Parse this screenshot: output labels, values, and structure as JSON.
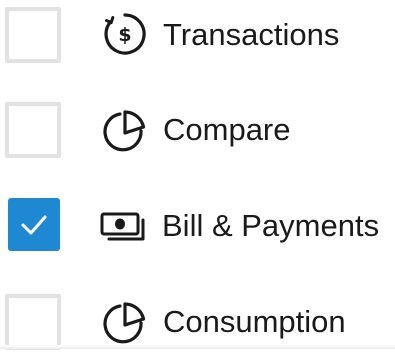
{
  "menu": {
    "items": [
      {
        "label": "Transactions",
        "checked": false,
        "icon": "dollar-circle-icon"
      },
      {
        "label": "Compare",
        "checked": false,
        "icon": "pie-chart-icon"
      },
      {
        "label": "Bill & Payments",
        "checked": true,
        "icon": "cash-icon"
      },
      {
        "label": "Consumption",
        "checked": false,
        "icon": "pie-chart-icon"
      }
    ]
  },
  "colors": {
    "accent": "#1e88d2",
    "checkbox_border": "#e2e2e2",
    "text": "#1a1a1a"
  }
}
